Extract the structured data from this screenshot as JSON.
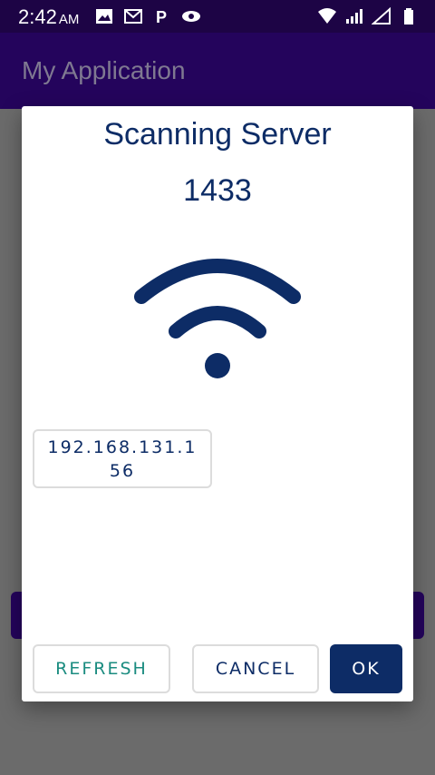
{
  "status_bar": {
    "time": "2:42",
    "ampm": "AM",
    "left_icons": [
      "image-icon",
      "gmail-icon",
      "p-app-icon",
      "eye-icon"
    ],
    "right_icons": [
      "wifi-signal-icon",
      "cell-signal-icon",
      "cell-signal-empty-icon",
      "battery-icon"
    ]
  },
  "app_bar": {
    "title": "My Application"
  },
  "dialog": {
    "title": "Scanning Server",
    "port": "1433",
    "icon": "wifi-icon",
    "server_item": "192.168.131.156",
    "buttons": {
      "refresh": "REFRESH",
      "cancel": "CANCEL",
      "ok": "OK"
    }
  },
  "colors": {
    "primary_dark": "#24045c",
    "dialog_text": "#0d2c66",
    "refresh_text": "#1b8c80",
    "ok_button_bg": "#0d2c66"
  }
}
